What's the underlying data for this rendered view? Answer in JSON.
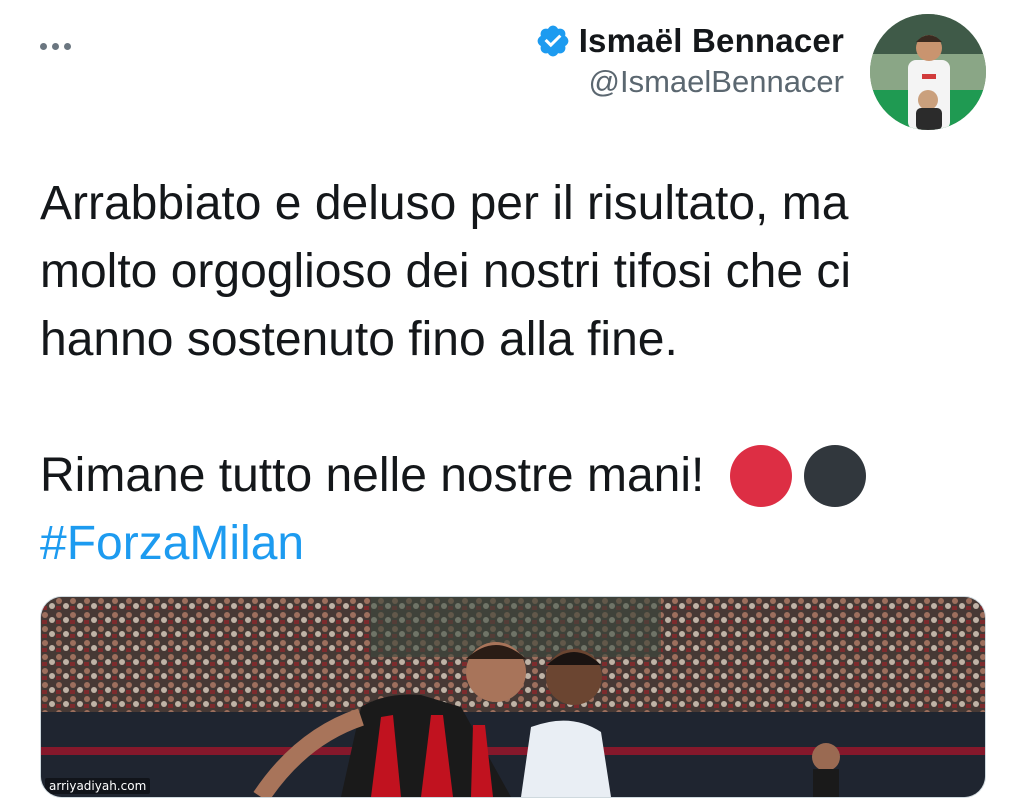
{
  "tweet": {
    "author": {
      "display_name": "Ismaël Bennacer",
      "handle": "@IsmaelBennacer",
      "verified": true
    },
    "text_lines": [
      "Arrabbiato e deluso per il risultato, ma",
      "molto orgoglioso dei nostri tifosi che ci",
      "hanno sostenuto fino alla fine.",
      "Rimane tutto nelle nostre mani!"
    ],
    "emojis": [
      "red-circle",
      "black-circle"
    ],
    "hashtag": "#ForzaMilan"
  },
  "watermark": "arriyadiyah.com",
  "colors": {
    "link": "#1d9bf0",
    "verified": "#1d9bf0",
    "red_circle": "#dd2e44",
    "black_circle": "#31373d"
  }
}
